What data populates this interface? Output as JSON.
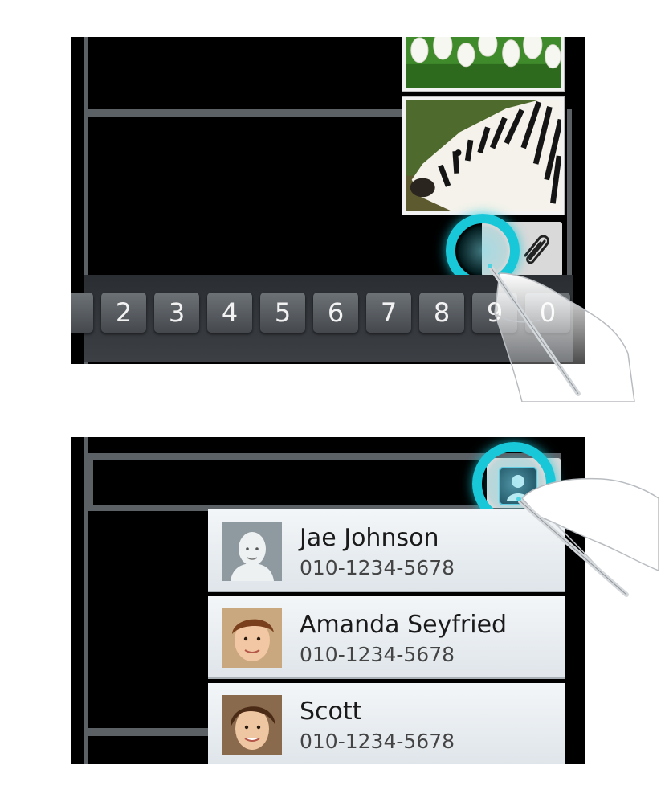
{
  "top_panel": {
    "dialpad_keys": [
      "2",
      "3",
      "4",
      "5",
      "6",
      "7",
      "8",
      "9",
      "0"
    ],
    "attachment_button_icon": "paperclip-icon",
    "gallery_images": [
      "tulips",
      "zebra"
    ]
  },
  "bottom_panel": {
    "contact_button_icon": "contact-icon",
    "contacts": [
      {
        "name": "Jae Johnson",
        "phone": "010-1234-5678",
        "avatar": "default-avatar"
      },
      {
        "name": "Amanda Seyfried",
        "phone": "010-1234-5678",
        "avatar": "photo"
      },
      {
        "name": "Scott",
        "phone": "010-1234-5678",
        "avatar": "photo"
      }
    ]
  },
  "colors": {
    "highlight_ring": "#19c8d8",
    "panel_background": "#000000",
    "list_background": "#e6ebef"
  }
}
